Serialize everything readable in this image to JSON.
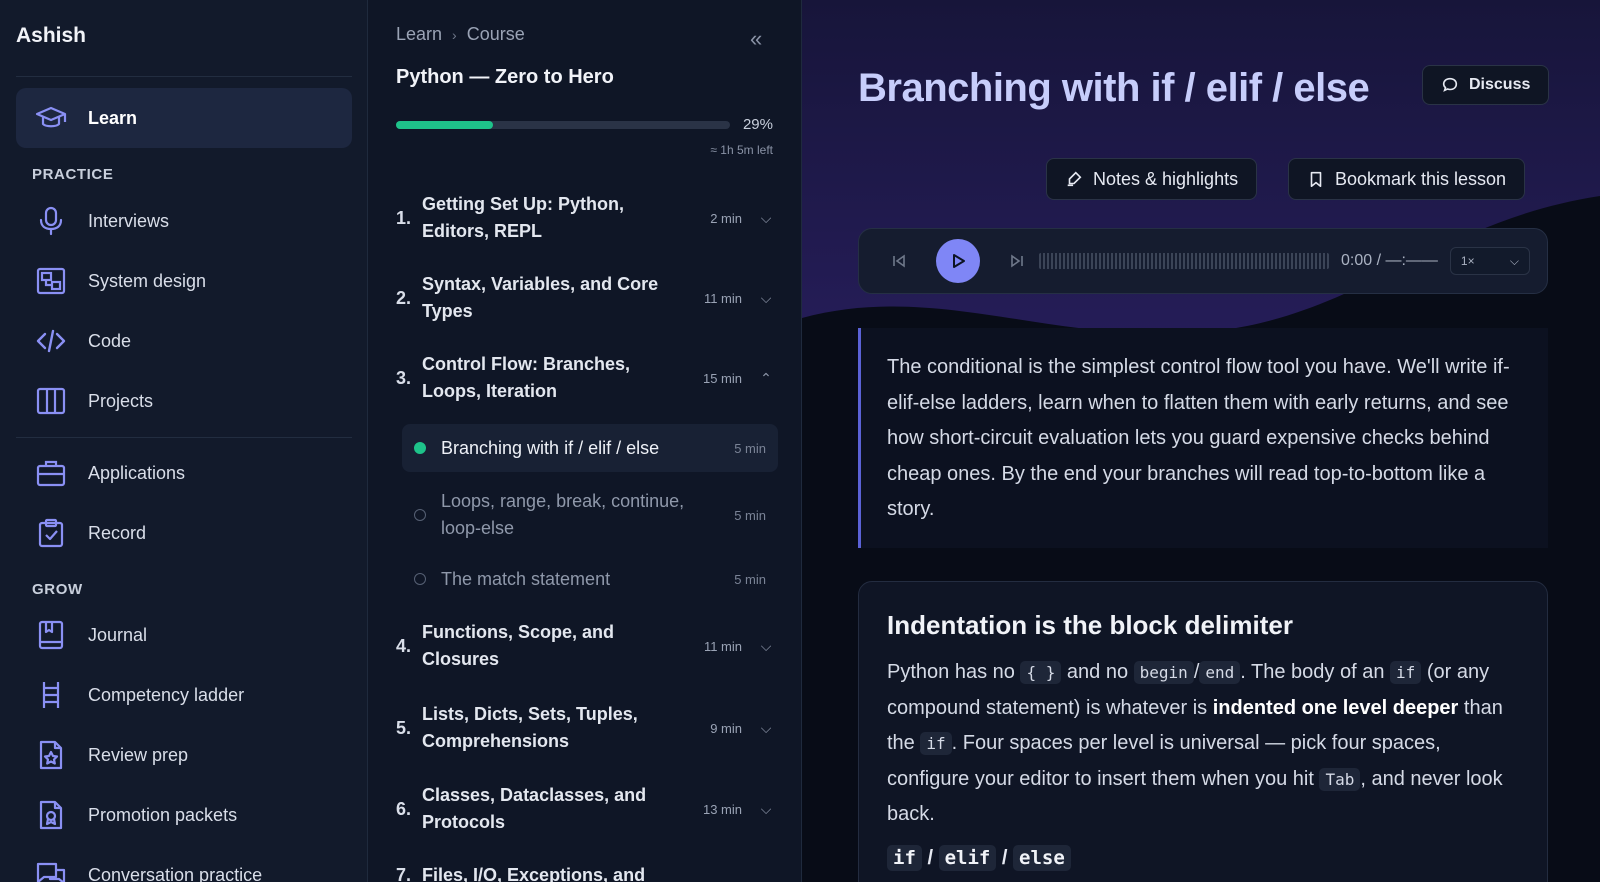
{
  "user": {
    "name": "Ashish"
  },
  "nav": {
    "learn": "Learn",
    "practice_header": "PRACTICE",
    "practice": [
      "Interviews",
      "System design",
      "Code",
      "Projects"
    ],
    "career": [
      "Applications",
      "Record"
    ],
    "grow_header": "GROW",
    "grow": [
      "Journal",
      "Competency ladder",
      "Review prep",
      "Promotion packets",
      "Conversation practice"
    ]
  },
  "course": {
    "breadcrumb": [
      "Learn",
      "Course"
    ],
    "title": "Python — Zero to Hero",
    "progress": 0.29,
    "progress_label": "29%",
    "time_left": "≈ 1h 5m left",
    "modules": [
      {
        "num": "1.",
        "title": "Getting Set Up: Python, Editors, REPL",
        "duration": "2 min"
      },
      {
        "num": "2.",
        "title": "Syntax, Variables, and Core Types",
        "duration": "11 min"
      },
      {
        "num": "3.",
        "title": "Control Flow: Branches, Loops, Iteration",
        "duration": "15 min"
      },
      {
        "num": "4.",
        "title": "Functions, Scope, and Closures",
        "duration": "11 min"
      },
      {
        "num": "5.",
        "title": "Lists, Dicts, Sets, Tuples, Comprehensions",
        "duration": "9 min"
      },
      {
        "num": "6.",
        "title": "Classes, Dataclasses, and Protocols",
        "duration": "13 min"
      },
      {
        "num": "7.",
        "title": "Files, I/O, Exceptions, and",
        "duration": ""
      }
    ],
    "lessons": [
      {
        "title": "Branching with if / elif / else",
        "duration": "5 min"
      },
      {
        "title": "Loops, range, break, continue, loop-else",
        "duration": "5 min"
      },
      {
        "title": "The match statement",
        "duration": "5 min"
      }
    ]
  },
  "lesson": {
    "title": "Branching with if / elif / else",
    "discuss_label": "Discuss",
    "notes_label": "Notes & highlights",
    "bookmark_label": "Bookmark this lesson",
    "player": {
      "time": "0:00 / —:——",
      "speed": "1×"
    },
    "summary": "The conditional is the simplest control flow tool you have. We'll write if-elif-else ladders, learn when to flatten them with early returns, and see how short-circuit evaluation lets you guard expensive checks behind cheap ones. By the end your branches will read top-to-bottom like a story.",
    "section": {
      "heading": "Indentation is the block delimiter",
      "t1": "Python has no ",
      "c1": "{ }",
      "t2": " and no ",
      "c2": "begin",
      "t3": "/",
      "c3": "end",
      "t4": ". The body of an ",
      "c4": "if",
      "t5": " (or any compound statement) is whatever is ",
      "b1": "indented one level deeper",
      "t6": " than the ",
      "c5": "if",
      "t7": ". Four spaces per level is universal — pick four spaces, configure your editor to insert them when you hit ",
      "c6": "Tab",
      "t8": ", and never look back.",
      "h1": "if",
      "hs1": " / ",
      "h2": "elif",
      "hs2": " / ",
      "h3": "else"
    }
  }
}
